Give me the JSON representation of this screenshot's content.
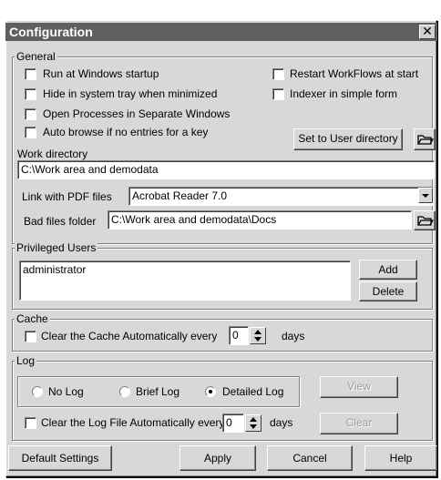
{
  "window": {
    "title": "Configuration"
  },
  "general": {
    "legend": "General",
    "run_at_startup": "Run at Windows startup",
    "hide_in_tray": "Hide in system tray when minimized",
    "open_separate": "Open Processes in Separate Windows",
    "auto_browse": "Auto browse if no entries for a key",
    "restart_workflows": "Restart WorkFlows at start",
    "indexer_simple": "Indexer in simple form",
    "set_user_dir_button": "Set to User directory",
    "work_dir_label": "Work directory",
    "work_dir_value": "C:\\Work area and demodata",
    "pdf_label": "Link with PDF files",
    "pdf_value": "Acrobat Reader 7.0",
    "bad_files_label": "Bad files folder",
    "bad_files_value": "C:\\Work area and demodata\\Docs"
  },
  "privileged": {
    "legend": "Privileged Users",
    "users": [
      "administrator"
    ],
    "add_button": "Add",
    "delete_button": "Delete"
  },
  "cache": {
    "legend": "Cache",
    "clear_label": "Clear the Cache Automatically every",
    "value": "0",
    "unit": "days"
  },
  "log": {
    "legend": "Log",
    "no_log": "No Log",
    "brief_log": "Brief Log",
    "detailed_log": "Detailed Log",
    "selected": "detailed",
    "view_button": "View",
    "clear_label": "Clear the Log File Automatically every",
    "value": "0",
    "unit": "days",
    "clear_button": "Clear"
  },
  "footer": {
    "default_settings": "Default Settings",
    "apply": "Apply",
    "cancel": "Cancel",
    "help": "Help"
  },
  "icons": {
    "close": "close-icon",
    "folder": "folder-open-icon",
    "dropdown": "chevron-down-icon"
  }
}
